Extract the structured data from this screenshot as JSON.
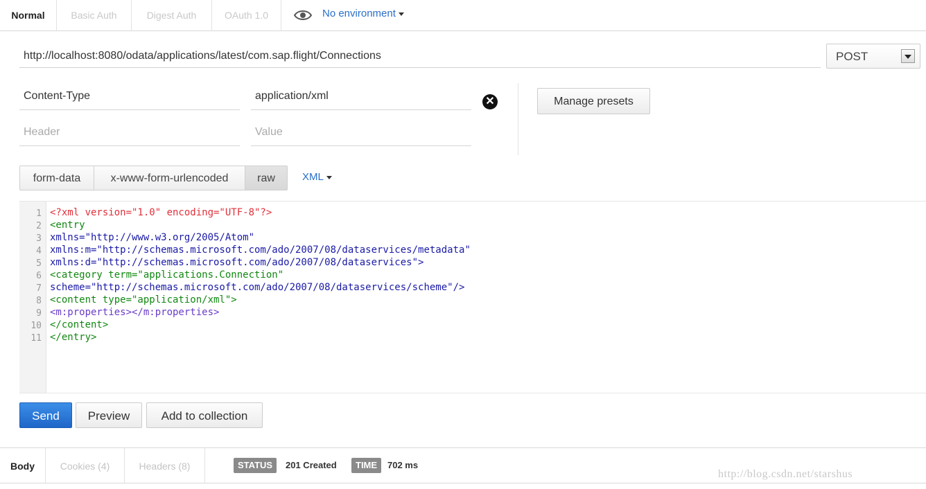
{
  "auth_tabs": [
    "Normal",
    "Basic Auth",
    "Digest Auth",
    "OAuth 1.0"
  ],
  "environment": {
    "label": "No environment",
    "icon": "eye-icon"
  },
  "request": {
    "url": "http://localhost:8080/odata/applications/latest/com.sap.flight/Connections",
    "method": "POST"
  },
  "headers": {
    "rows": [
      {
        "key": "Content-Type",
        "value": "application/xml"
      }
    ],
    "key_placeholder": "Header",
    "value_placeholder": "Value",
    "manage_presets_label": "Manage presets"
  },
  "body_types": [
    "form-data",
    "x-www-form-urlencoded",
    "raw"
  ],
  "body_type_selected": "raw",
  "raw_format": "XML",
  "editor": {
    "line_numbers": [
      "1",
      "2",
      "3",
      "4",
      "5",
      "6",
      "7",
      "8",
      "9",
      "10",
      "11"
    ],
    "lines": [
      "<?xml version=\"1.0\" encoding=\"UTF-8\"?>",
      "<entry",
      "xmlns=\"http://www.w3.org/2005/Atom\"",
      "xmlns:m=\"http://schemas.microsoft.com/ado/2007/08/dataservices/metadata\"",
      "xmlns:d=\"http://schemas.microsoft.com/ado/2007/08/dataservices\">",
      "<category term=\"applications.Connection\"",
      "scheme=\"http://schemas.microsoft.com/ado/2007/08/dataservices/scheme\"/>",
      "<content type=\"application/xml\">",
      "<m:properties></m:properties>",
      "</content>",
      "</entry>"
    ]
  },
  "actions": {
    "send": "Send",
    "preview": "Preview",
    "add_to_collection": "Add to collection"
  },
  "response_tabs": [
    "Body",
    "Cookies (4)",
    "Headers (8)"
  ],
  "response": {
    "status_label": "STATUS",
    "status_value": "201 Created",
    "time_label": "TIME",
    "time_value": "702 ms"
  },
  "watermark": "http://blog.csdn.net/starshus",
  "colors": {
    "send_button": "#2870d0",
    "link_blue": "#2a6fc9",
    "xml_decl": "#e0303a",
    "xml_tag": "#118811",
    "xml_string": "#1a1aa6"
  }
}
